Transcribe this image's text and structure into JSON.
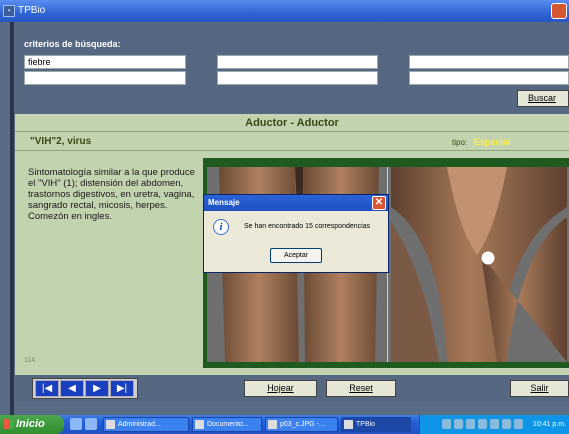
{
  "window": {
    "title": "TPBio"
  },
  "search": {
    "label": "criterios de búsqueda:",
    "fields": [
      "fiebre",
      "",
      "",
      "",
      "",
      ""
    ],
    "button": "Buscar"
  },
  "record": {
    "header": "Aductor  -  Aductor",
    "name": "\"VIH\"2, virus",
    "tipo_label": "tipo:",
    "tipo_value": "Especial",
    "description": "Sintomatología similar a la que produce el \"VIH\" (1); distensión del abdomen, trastornos digestivos, en uretra, vagina, sangrado rectal, micosis, herpes. Comezón en ingles.",
    "page_number": "114"
  },
  "dialog": {
    "title": "Mensaje",
    "message": "Se han encontrado 15 correspondencias",
    "button": "Aceptar"
  },
  "toolbar": {
    "hojear": "Hojear",
    "reset": "Reset",
    "salir": "Salir"
  },
  "taskbar": {
    "start": "Inicio",
    "tasks": [
      "Administrad...",
      "Documento...",
      "p03_c.JPG -...",
      "TPBio"
    ],
    "language": "ES",
    "clock": "10:41 p.m."
  },
  "colors": {
    "panel_green": "#c2d3b0",
    "tipo_highlight": "#ffee44",
    "frame_green": "#1f5a1f"
  }
}
